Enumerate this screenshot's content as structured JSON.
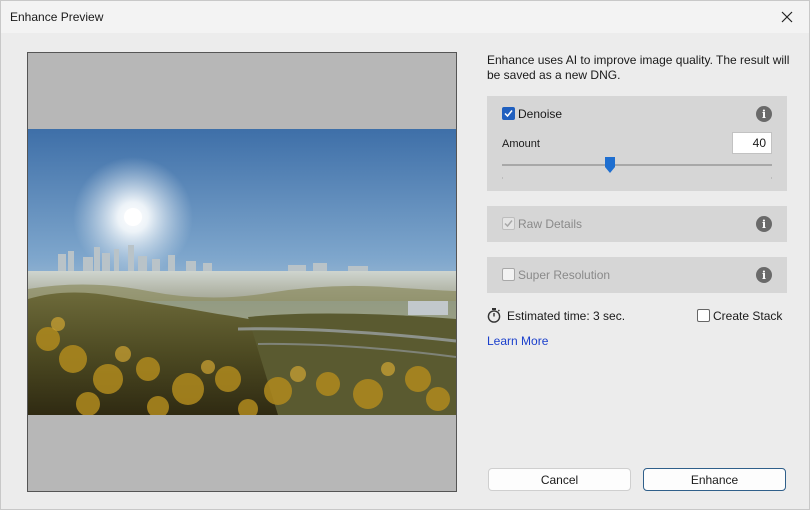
{
  "window": {
    "title": "Enhance Preview",
    "close_icon": "close-icon"
  },
  "description": "Enhance uses AI to improve image quality. The result will be saved as a new DNG.",
  "denoise": {
    "label": "Denoise",
    "checked": true,
    "amount_label": "Amount",
    "amount_value": "40",
    "amount_fraction": 0.4,
    "info_icon": "info-icon"
  },
  "raw_details": {
    "label": "Raw Details",
    "checked": true,
    "disabled": true,
    "info_icon": "info-icon"
  },
  "super_resolution": {
    "label": "Super Resolution",
    "checked": false,
    "disabled": true,
    "info_icon": "info-icon"
  },
  "estimate": {
    "icon": "stopwatch-icon",
    "text": "Estimated time: 3 sec."
  },
  "create_stack": {
    "label": "Create Stack",
    "checked": false
  },
  "learn_more": "Learn More",
  "buttons": {
    "cancel": "Cancel",
    "enhance": "Enhance"
  },
  "colors": {
    "accent": "#1f5fbf",
    "link": "#1a3fcc",
    "panel": "#d6d6d6",
    "preview_bg": "#b7b7b7"
  }
}
